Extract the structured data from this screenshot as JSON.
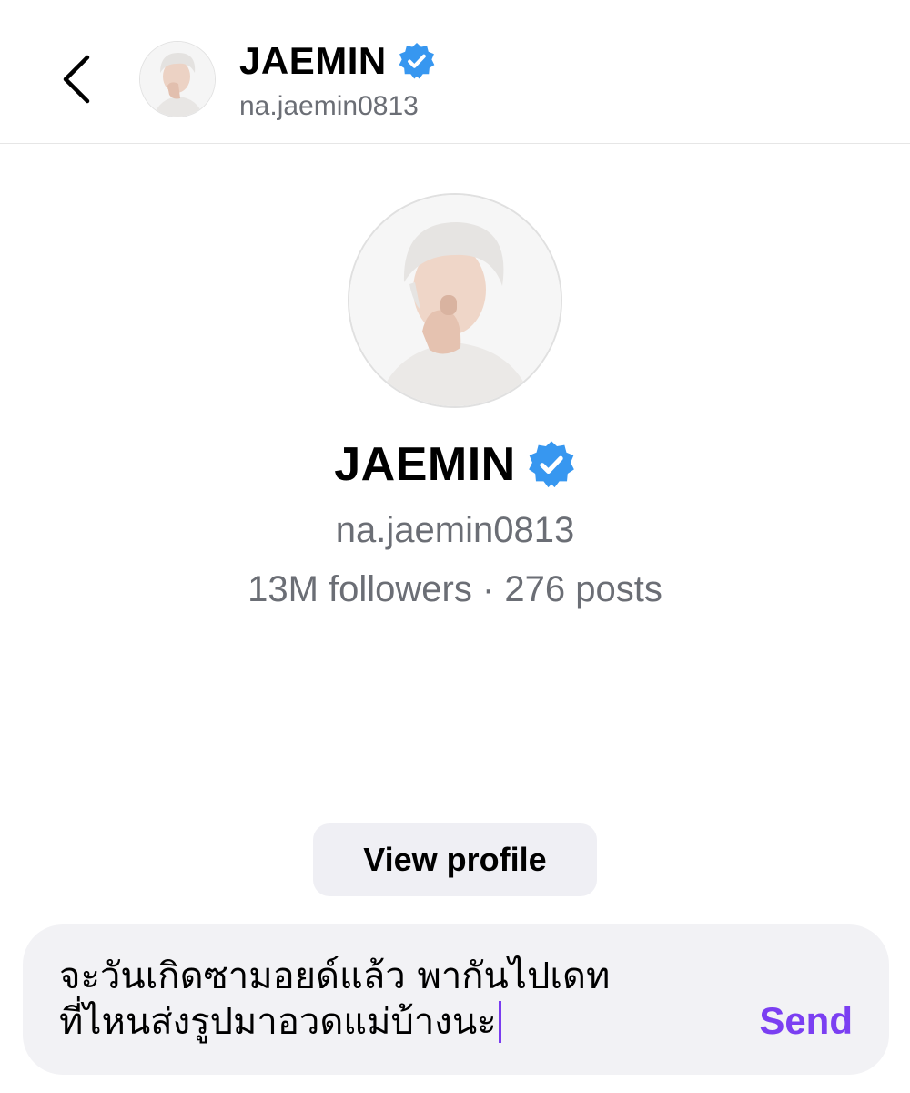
{
  "header": {
    "display_name": "JAEMIN",
    "handle": "na.jaemin0813"
  },
  "profile": {
    "display_name": "JAEMIN",
    "handle": "na.jaemin0813",
    "stats": "13M followers · 276 posts",
    "view_profile_label": "View profile"
  },
  "composer": {
    "message": "จะวันเกิดซามอยด์แล้ว พากันไปเดท\nที่ไหนส่งรูปมาอวดแม่บ้างนะ",
    "send_label": "Send"
  },
  "colors": {
    "verified_badge": "#3797f0",
    "send_accent": "#7b3ff2",
    "secondary_text": "#6b6e75",
    "button_background": "#efeff4",
    "composer_background": "#f2f2f5"
  },
  "icons": {
    "back": "chevron-left-icon",
    "verified": "verified-badge-icon"
  }
}
